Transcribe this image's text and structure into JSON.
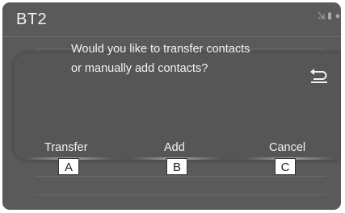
{
  "screen": {
    "title": "BT2"
  },
  "status_icons": [
    "bluetooth-muted-icon",
    "phone-battery-icon",
    "signal-icon"
  ],
  "dialog": {
    "message_line1": "Would you like to transfer contacts",
    "message_line2": "or manually add contacts?",
    "back_icon": "back-arrow-icon",
    "options": [
      {
        "label": "Transfer",
        "callout": "A"
      },
      {
        "label": "Add",
        "callout": "B"
      },
      {
        "label": "Cancel",
        "callout": "C"
      }
    ]
  },
  "colors": {
    "screen_background": "#5a5a5a",
    "text": "#f3f3f3",
    "callout_background": "#ffffff"
  }
}
